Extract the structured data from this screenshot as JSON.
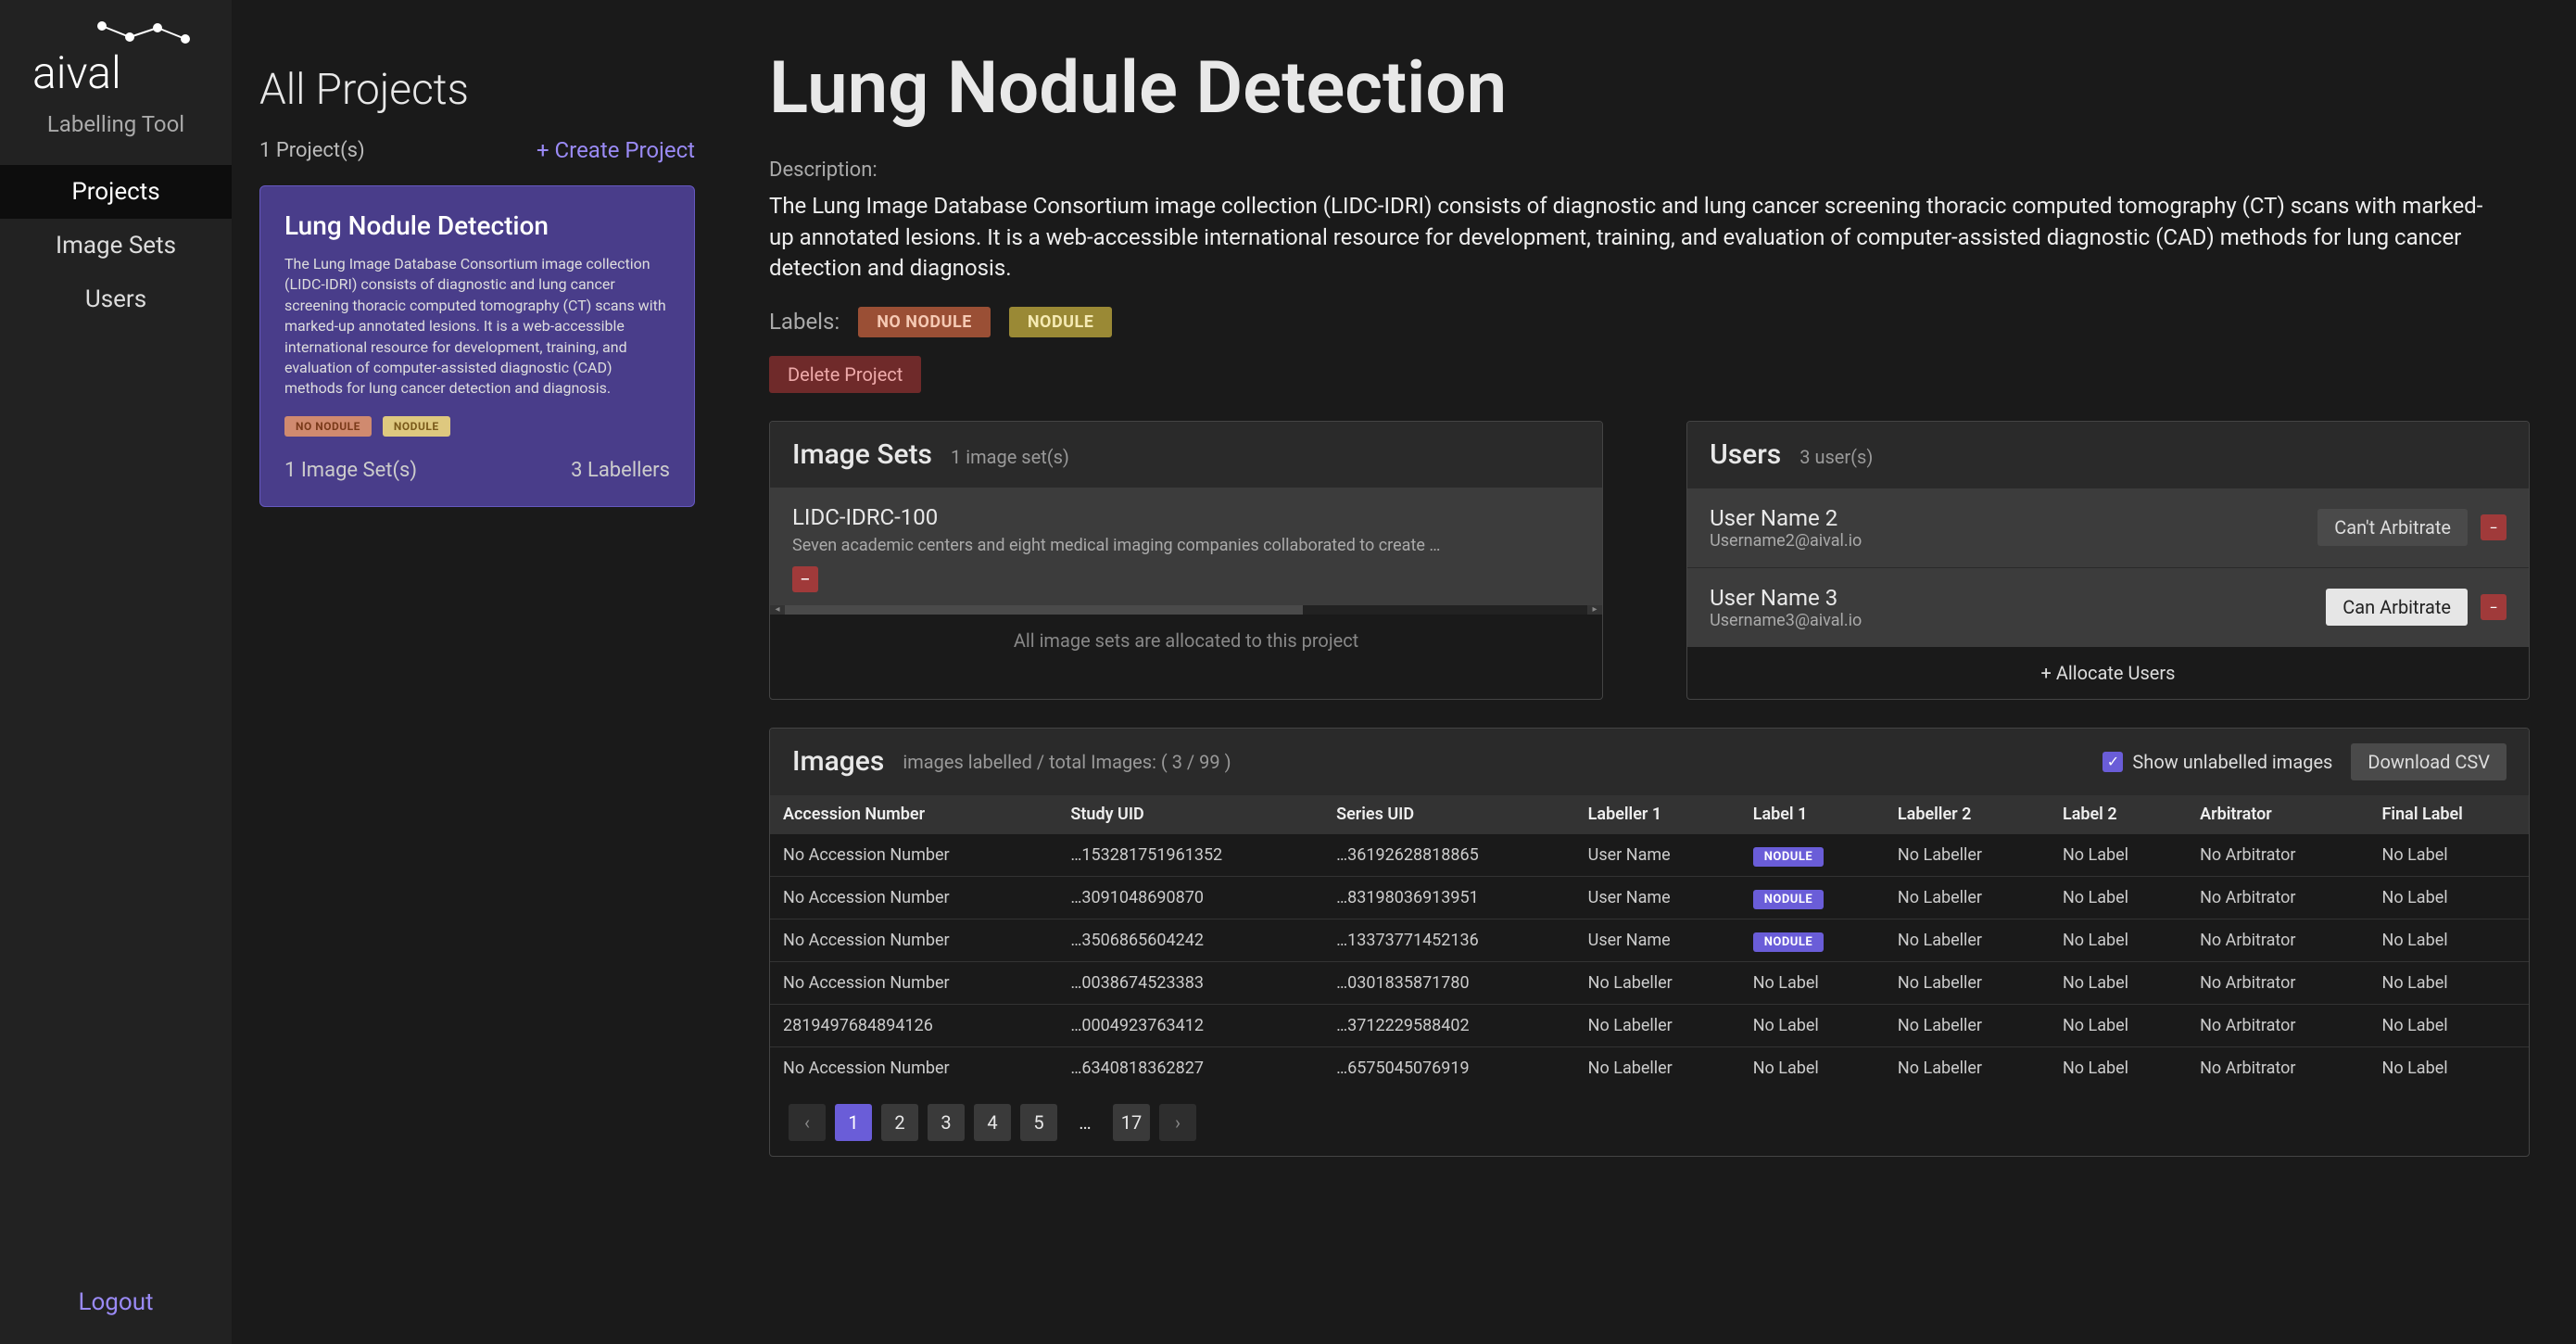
{
  "brand": {
    "name": "aival",
    "subtitle": "Labelling Tool"
  },
  "nav": {
    "projects": "Projects",
    "image_sets": "Image Sets",
    "users": "Users",
    "logout": "Logout"
  },
  "left": {
    "title": "All Projects",
    "count": "1 Project(s)",
    "create": "+ Create Project",
    "card": {
      "title": "Lung Nodule Detection",
      "desc": "The Lung Image Database Consortium image collection (LIDC-IDRI) consists of diagnostic and lung cancer screening thoracic computed tomography (CT) scans with marked-up annotated lesions. It is a web-accessible international resource for development, training, and evaluation of computer-assisted diagnostic (CAD) methods for lung cancer detection and diagnosis.",
      "badge1": "NO NODULE",
      "badge2": "NODULE",
      "imgsets": "1 Image Set(s)",
      "labellers": "3 Labellers"
    }
  },
  "right": {
    "title": "Lung Nodule Detection",
    "desc_label": "Description:",
    "desc": "The Lung Image Database Consortium image collection (LIDC-IDRI) consists of diagnostic and lung cancer screening thoracic computed tomography (CT) scans with marked-up annotated lesions. It is a web-accessible international resource for development, training, and evaluation of computer-assisted diagnostic (CAD) methods for lung cancer detection and diagnosis.",
    "labels_label": "Labels:",
    "tag1": "NO NODULE",
    "tag2": "NODULE",
    "delete": "Delete Project"
  },
  "imgset_panel": {
    "title": "Image Sets",
    "count": "1 image set(s)",
    "item_name": "LIDC-IDRC-100",
    "item_desc": "Seven academic centers and eight medical imaging companies collaborated to create …",
    "footer": "All image sets are allocated to this project"
  },
  "users_panel": {
    "title": "Users",
    "count": "3 user(s)",
    "items": [
      {
        "name": "User Name 2",
        "email": "Username2@aival.io",
        "arb": "Can't Arbitrate",
        "arb_class": "cant"
      },
      {
        "name": "User Name 3",
        "email": "Username3@aival.io",
        "arb": "Can Arbitrate",
        "arb_class": "can"
      }
    ],
    "footer": "+ Allocate Users"
  },
  "images_panel": {
    "title": "Images",
    "sub": "images labelled / total Images: ( 3 / 99 )",
    "checkbox_label": "Show unlabelled images",
    "download": "Download CSV",
    "columns": [
      "Accession Number",
      "Study UID",
      "Series UID",
      "Labeller 1",
      "Label 1",
      "Labeller 2",
      "Label 2",
      "Arbitrator",
      "Final Label"
    ],
    "rows": [
      {
        "acc": "No Accession Number",
        "study": "…153281751961352",
        "series": "…36192628818865",
        "l1": "User Name",
        "lb1": "NODULE",
        "l2": "No Labeller",
        "lb2": "No Label",
        "arb": "No Arbitrator",
        "fl": "No Label"
      },
      {
        "acc": "No Accession Number",
        "study": "…3091048690870",
        "series": "…83198036913951",
        "l1": "User Name",
        "lb1": "NODULE",
        "l2": "No Labeller",
        "lb2": "No Label",
        "arb": "No Arbitrator",
        "fl": "No Label"
      },
      {
        "acc": "No Accession Number",
        "study": "…3506865604242",
        "series": "…13373771452136",
        "l1": "User Name",
        "lb1": "NODULE",
        "l2": "No Labeller",
        "lb2": "No Label",
        "arb": "No Arbitrator",
        "fl": "No Label"
      },
      {
        "acc": "No Accession Number",
        "study": "…0038674523383",
        "series": "…0301835871780",
        "l1": "No Labeller",
        "lb1": "No Label",
        "l2": "No Labeller",
        "lb2": "No Label",
        "arb": "No Arbitrator",
        "fl": "No Label"
      },
      {
        "acc": "2819497684894126",
        "study": "…0004923763412",
        "series": "…3712229588402",
        "l1": "No Labeller",
        "lb1": "No Label",
        "l2": "No Labeller",
        "lb2": "No Label",
        "arb": "No Arbitrator",
        "fl": "No Label"
      },
      {
        "acc": "No Accession Number",
        "study": "…6340818362827",
        "series": "…6575045076919",
        "l1": "No Labeller",
        "lb1": "No Label",
        "l2": "No Labeller",
        "lb2": "No Label",
        "arb": "No Arbitrator",
        "fl": "No Label"
      }
    ],
    "pages": [
      "1",
      "2",
      "3",
      "4",
      "5",
      "17"
    ],
    "ellipsis": "…"
  }
}
